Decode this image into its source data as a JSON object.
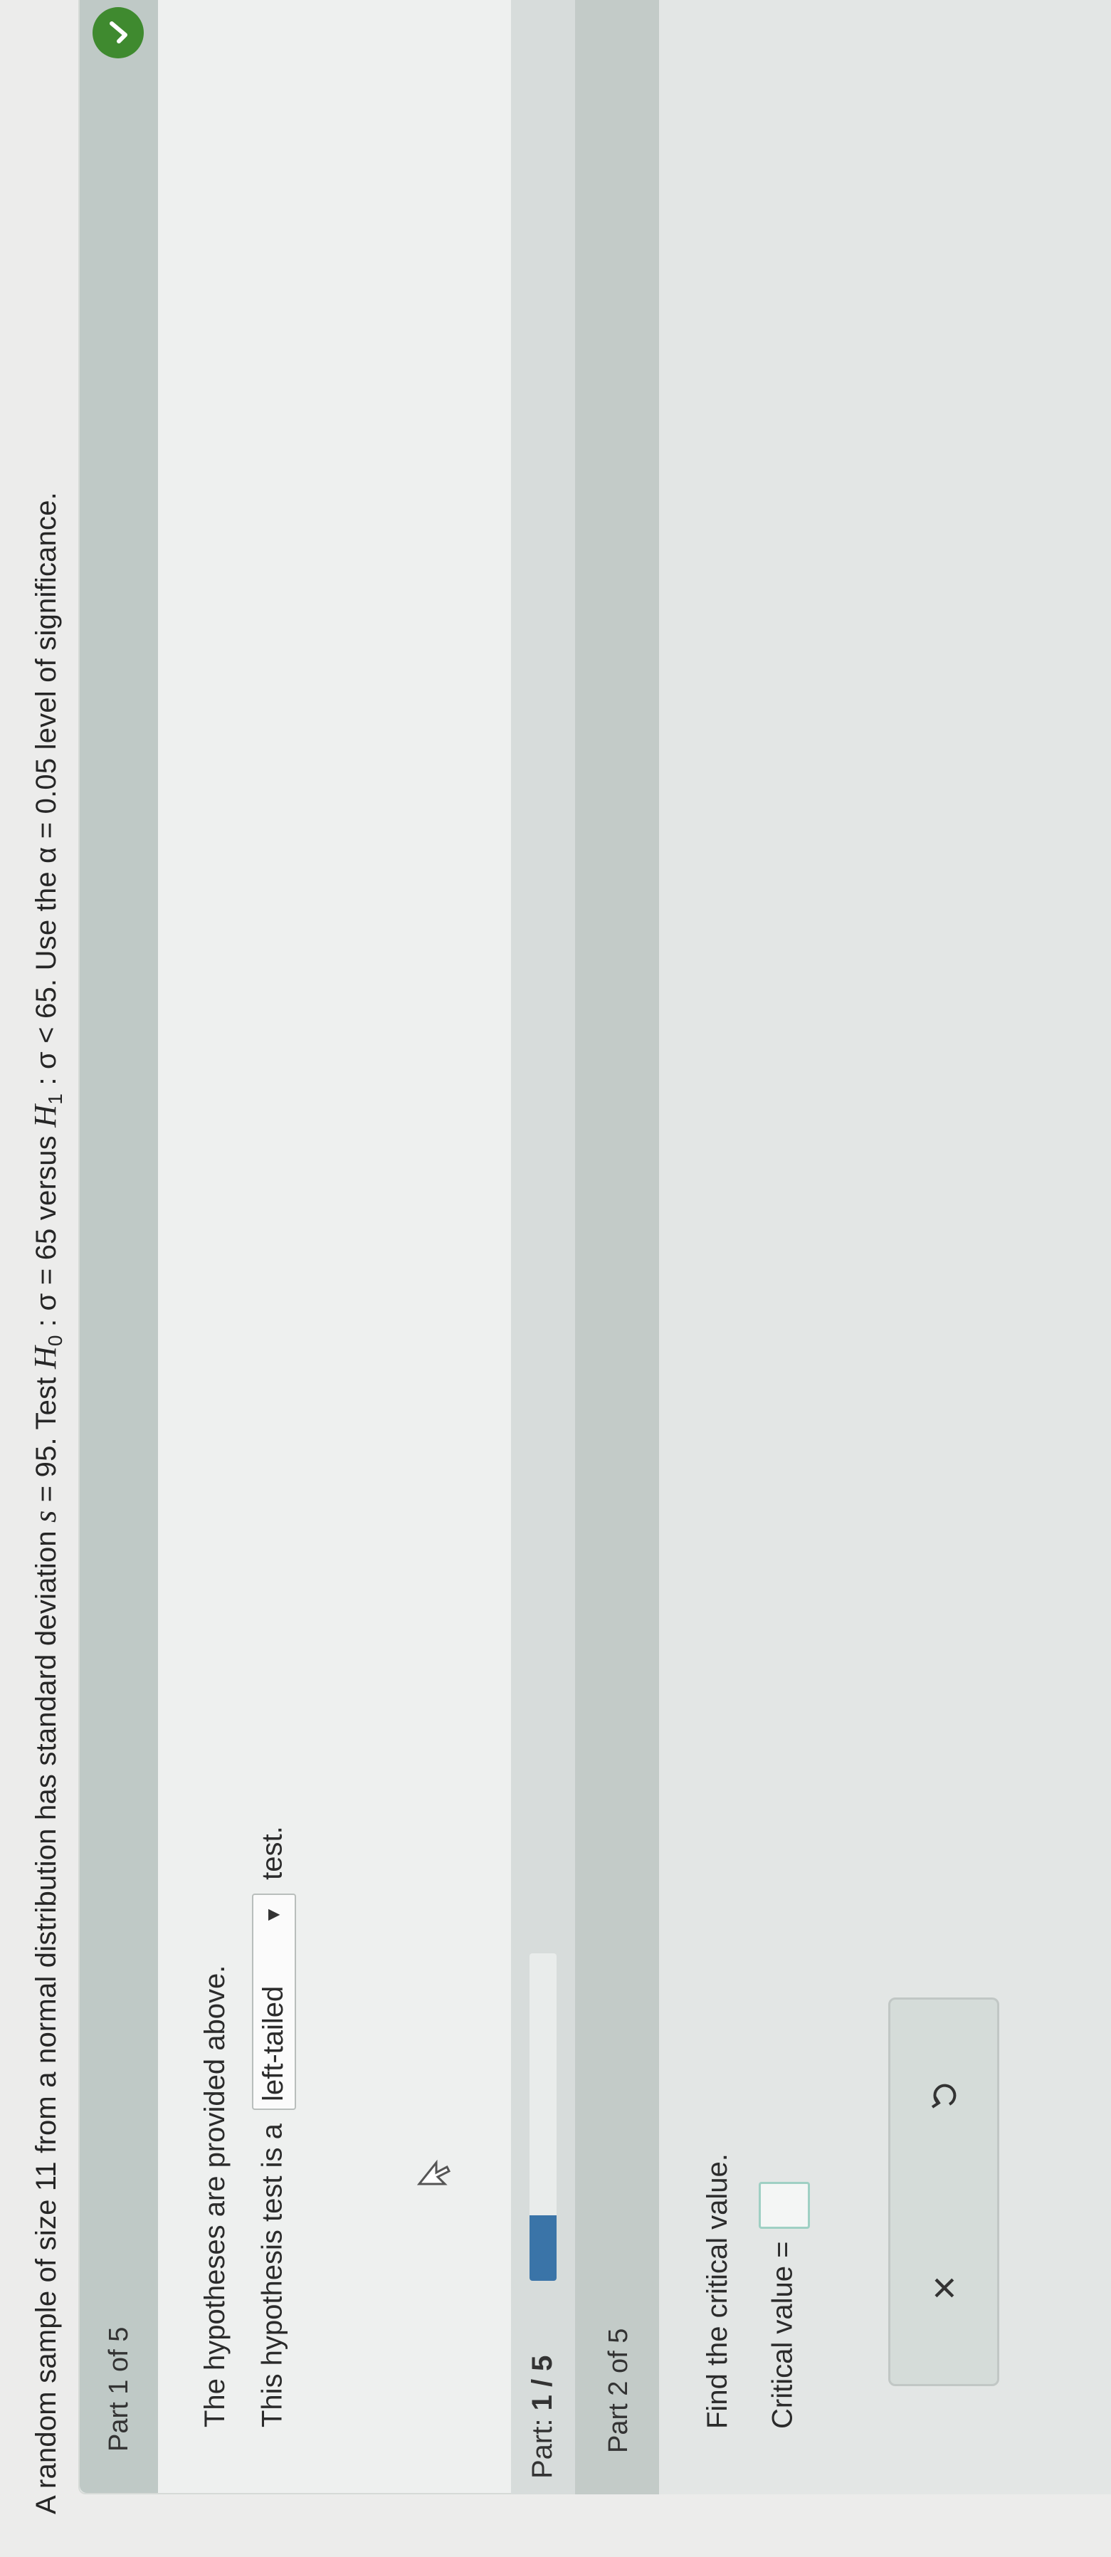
{
  "problem": {
    "text_before": "A random sample of size 11 from a normal distribution has standard deviation ",
    "s_symbol": "s",
    "s_value": " = 95. Test ",
    "h0": "H",
    "h0_sub": "0",
    "h0_text": " : σ = 65 versus ",
    "h1": "H",
    "h1_sub": "1",
    "h1_text": " : σ < 65. Use the ",
    "alpha_text": "α = 0.05",
    "text_after": " level of significance."
  },
  "part1": {
    "title": "Part 1 of 5",
    "line1": "The hypotheses are provided above.",
    "line2_before": "This hypothesis test is a",
    "dropdown_value": "left-tailed",
    "line2_after": "test.",
    "status": "check-icon",
    "status_color": "#3f8a2f"
  },
  "progress": {
    "label": "Part: ",
    "current": "1 / 5",
    "fraction": 0.2,
    "color": "#3a74a8"
  },
  "part2": {
    "title": "Part 2 of 5",
    "instruction": "Find the critical value.",
    "answer_label": "Critical value ="
  },
  "tools": {
    "clear_label": "×",
    "undo_icon": "undo-icon"
  }
}
